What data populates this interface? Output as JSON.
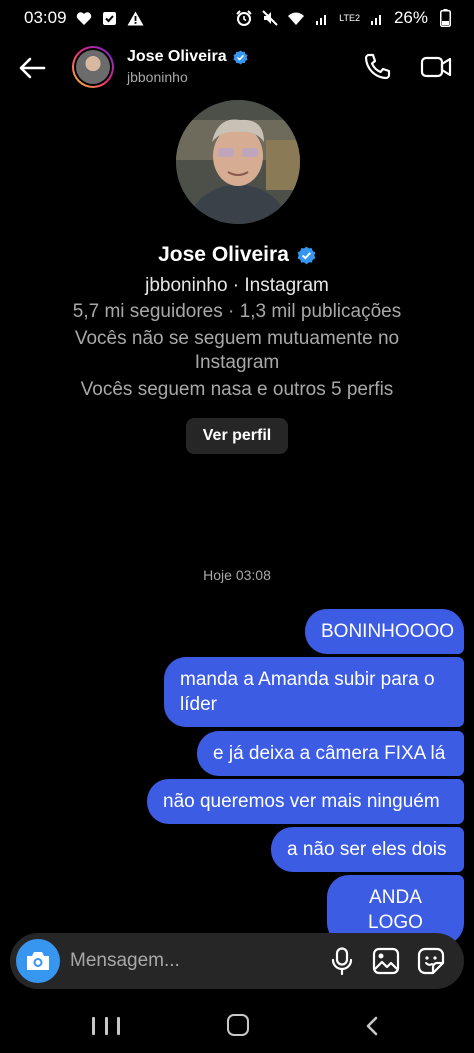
{
  "status_bar": {
    "time": "03:09",
    "battery": "26%",
    "network": "LTE2"
  },
  "header": {
    "name": "Jose Oliveira",
    "handle": "jbboninho"
  },
  "profile": {
    "name": "Jose Oliveira",
    "subtitle": "jbboninho · Instagram",
    "stats": "5,7 mi seguidores · 1,3 mil publicações",
    "mutual": "Vocês não se seguem mutuamente no Instagram",
    "follow_info": "Vocês seguem nasa e outros 5 perfis",
    "view_profile_label": "Ver perfil"
  },
  "conversation": {
    "timestamp": "Hoje 03:08",
    "messages": [
      "BONINHOOOO",
      "manda a Amanda subir para o líder",
      "e já deixa a câmera FIXA lá",
      "não queremos ver mais ninguém",
      "a não ser eles dois",
      "ANDA LOGO"
    ]
  },
  "composer": {
    "placeholder": "Mensagem..."
  },
  "colors": {
    "bubble": "#3c5ce4",
    "verified": "#3797f0",
    "camera": "#3797f0",
    "background": "#000000"
  }
}
